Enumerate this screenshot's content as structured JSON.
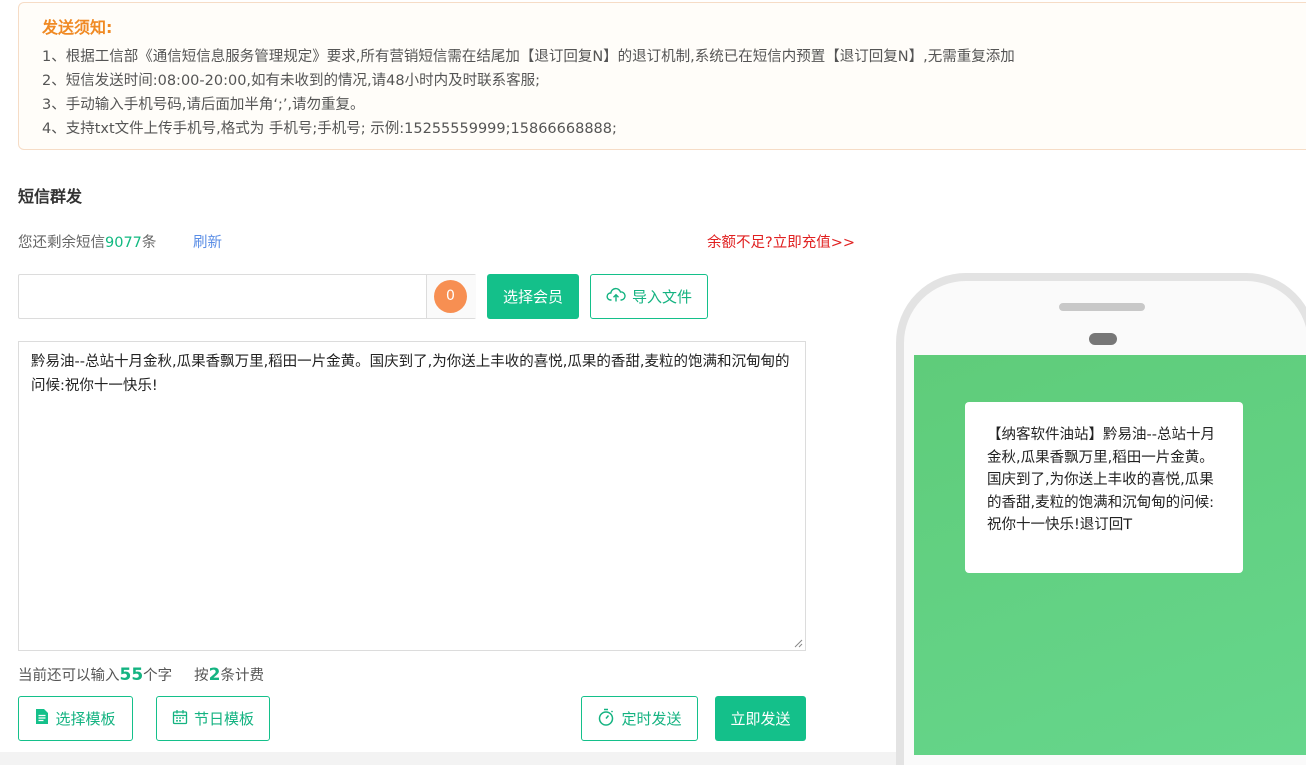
{
  "notice": {
    "title": "发送须知:",
    "lines": [
      "1、根据工信部《通信短信息服务管理规定》要求,所有营销短信需在结尾加【退订回复N】的退订机制,系统已在短信内预置【退订回复N】,无需重复添加",
      "2、短信发送时间:08:00-20:00,如有未收到的情况,请48小时内及时联系客服;",
      "3、手动输入手机号码,请后面加半角‘;’,请勿重复。",
      "4、支持txt文件上传手机号,格式为 手机号;手机号; 示例:15255559999;15866668888;"
    ]
  },
  "section_title": "短信群发",
  "balance": {
    "prefix": "您还剩余短信",
    "count": "9077",
    "suffix": "条",
    "refresh_label": "刷新",
    "recharge_label": "余额不足?立即充值>>"
  },
  "recipients": {
    "phone_value": "",
    "count_badge": "0",
    "select_member_label": "选择会员",
    "import_file_label": "导入文件"
  },
  "message": {
    "content": "黔易油--总站十月金秋,瓜果香飘万里,稻田一片金黄。国庆到了,为你送上丰收的喜悦,瓜果的香甜,麦粒的饱满和沉甸甸的问候:祝你十一快乐!"
  },
  "counter": {
    "remaining_prefix": "当前还可以输入",
    "remaining_count": "55",
    "remaining_suffix": "个字",
    "billing_prefix": "按",
    "billing_count": "2",
    "billing_suffix": "条计费"
  },
  "actions": {
    "choose_template_label": "选择模板",
    "holiday_template_label": "节日模板",
    "timed_send_label": "定时发送",
    "send_now_label": "立即发送"
  },
  "preview": {
    "message": "【纳客软件油站】黔易油--总站十月金秋,瓜果香飘万里,稻田一片金黄。国庆到了,为你送上丰收的喜悦,瓜果的香甜,麦粒的饱满和沉甸甸的问候:祝你十一快乐!退订回T"
  },
  "colors": {
    "accent": "#14c08a",
    "notice_title": "#f08a24",
    "recharge": "#e02020",
    "refresh": "#5b8ee6",
    "badge": "#f78f52",
    "phone_screen": "#66d68c"
  },
  "icons": {
    "import": "cloud-upload-icon",
    "choose_template": "document-icon",
    "holiday_template": "calendar-icon",
    "timed_send": "stopwatch-icon"
  }
}
